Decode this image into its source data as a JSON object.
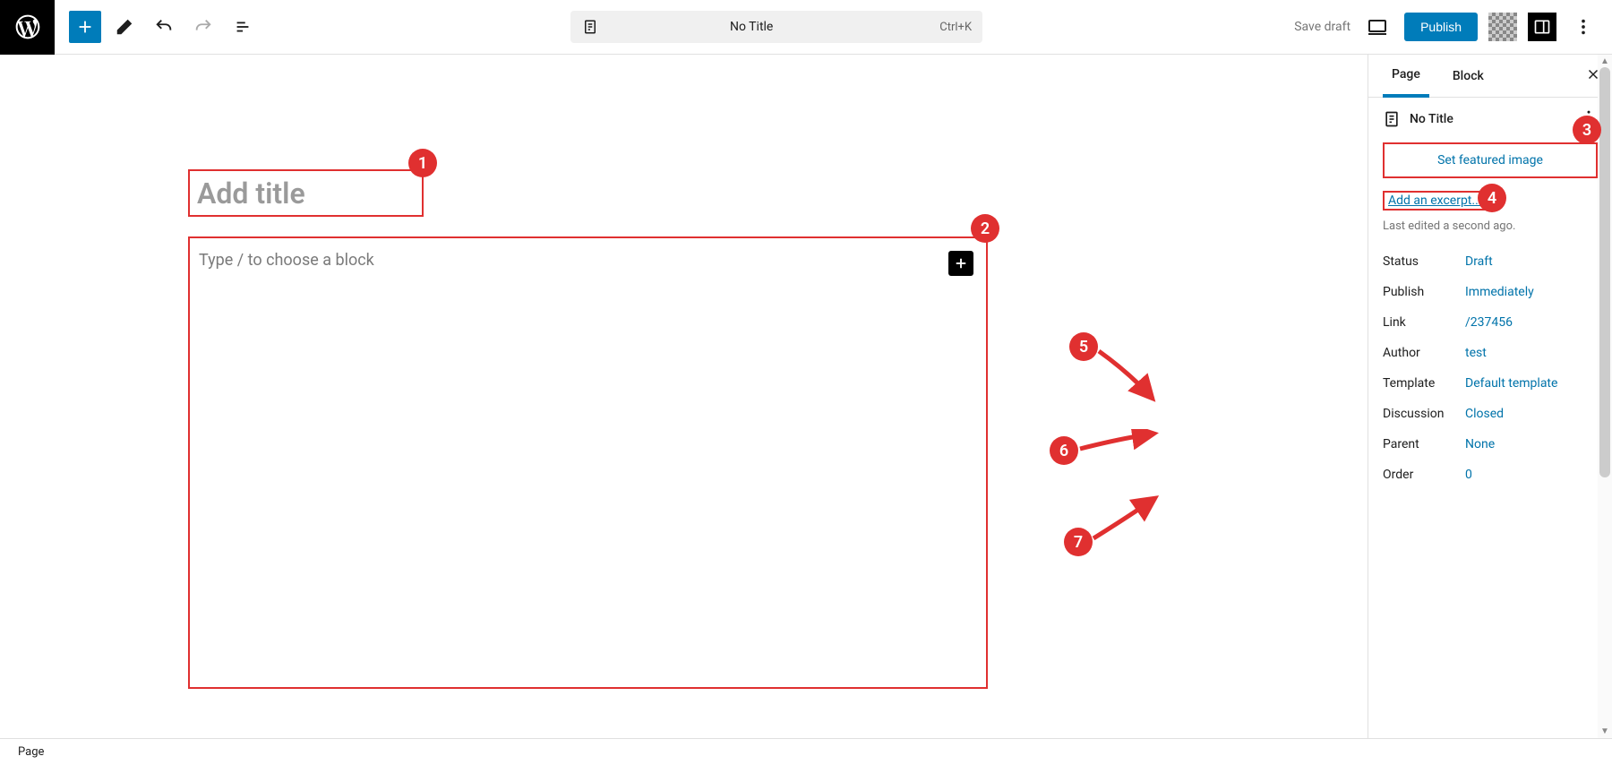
{
  "topbar": {
    "doc_title": "No Title",
    "shortcut": "Ctrl+K",
    "save_draft": "Save draft",
    "publish": "Publish"
  },
  "editor": {
    "title_placeholder": "Add title",
    "content_placeholder": "Type / to choose a block"
  },
  "sidebar": {
    "tabs": {
      "page": "Page",
      "block": "Block"
    },
    "panel_title": "No Title",
    "featured_image": "Set featured image",
    "excerpt": "Add an excerpt...",
    "last_edited": "Last edited a second ago.",
    "meta": {
      "status_label": "Status",
      "status_value": "Draft",
      "publish_label": "Publish",
      "publish_value": "Immediately",
      "link_label": "Link",
      "link_value": "/237456",
      "author_label": "Author",
      "author_value": "test",
      "template_label": "Template",
      "template_value": "Default template",
      "discussion_label": "Discussion",
      "discussion_value": "Closed",
      "parent_label": "Parent",
      "parent_value": "None",
      "order_label": "Order",
      "order_value": "0"
    }
  },
  "footer": {
    "breadcrumb": "Page"
  },
  "annotations": {
    "n1": "1",
    "n2": "2",
    "n3": "3",
    "n4": "4",
    "n5": "5",
    "n6": "6",
    "n7": "7"
  }
}
